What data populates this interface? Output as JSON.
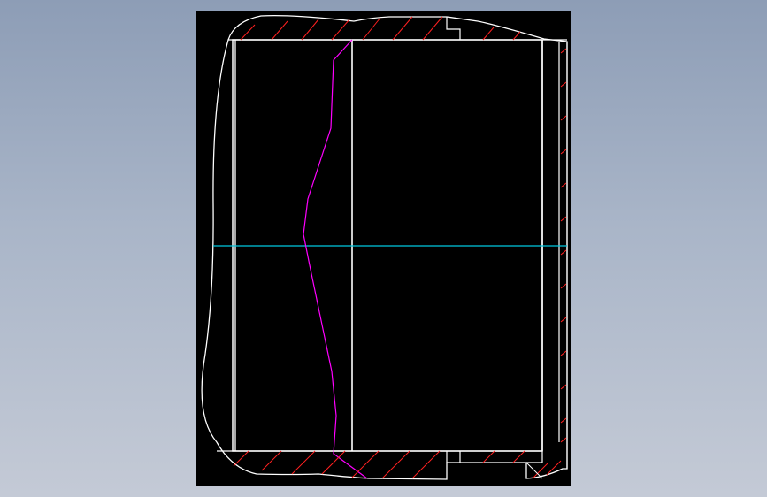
{
  "canvas": {
    "background_color": "#8d9db6",
    "viewport_color": "#000000"
  },
  "colors": {
    "outline": "#ffffff",
    "centerline": "#00c8e0",
    "profile": "#ff00ff",
    "hatch": "#ff2020"
  }
}
